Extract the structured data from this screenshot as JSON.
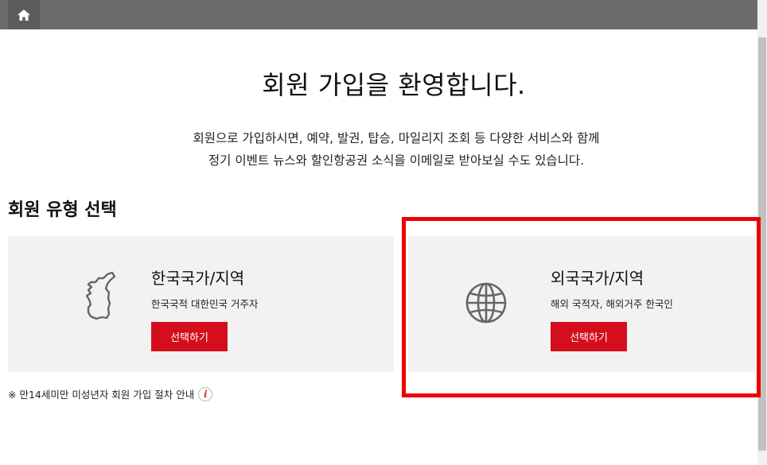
{
  "header": {
    "home_icon": "home-icon"
  },
  "main": {
    "title": "회원 가입을 환영합니다.",
    "intro_line1": "회원으로 가입하시면, 예약, 발권, 탑승, 마일리지 조회 등 다양한 서비스와 함께",
    "intro_line2": "정기 이벤트 뉴스와 할인항공권 소식을 이메일로 받아보실 수도 있습니다."
  },
  "member_type": {
    "section_title": "회원 유형 선택",
    "cards": [
      {
        "icon": "korea-map-icon",
        "title": "한국국가/지역",
        "desc": "한국국적 대한민국 거주자",
        "button": "선택하기"
      },
      {
        "icon": "globe-icon",
        "title": "외국국가/지역",
        "desc": "해외 국적자, 해외거주 한국인",
        "button": "선택하기"
      }
    ]
  },
  "notice": {
    "text": "※ 만14세미만 미성년자 회원 가입 절차 안내",
    "info_icon": "i"
  },
  "colors": {
    "accent": "#d40e1c",
    "highlight": "#ee0000",
    "topbar": "#6b6b6b",
    "card_bg": "#f2f2f2"
  }
}
